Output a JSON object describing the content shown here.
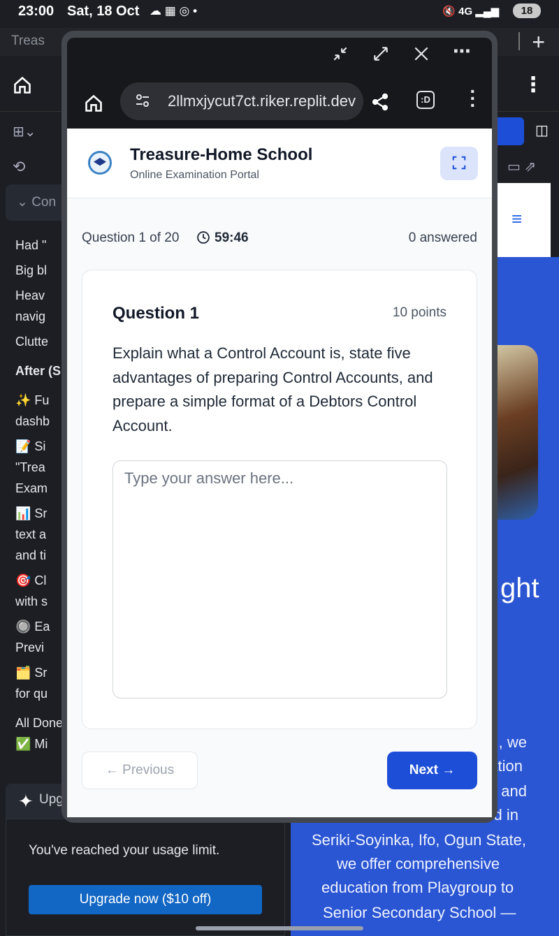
{
  "status_bar": {
    "time": "23:00",
    "date": "Sat, 18 Oct",
    "battery": "18"
  },
  "background": {
    "tab_title": "Treas",
    "conversation_label": "Con",
    "left_lines": [
      "Had \"",
      "Big bl",
      "Heav",
      "navig",
      "Clutte",
      "After (S",
      "✨ Fu",
      "dashb",
      "📝 Si",
      "\"Trea",
      "Exam",
      "📊 Sr",
      "text a",
      "and ti",
      "🎯 Cl",
      "with s",
      "🔘 Ea",
      "Previ",
      "🗂️ Sr",
      "for qu",
      "All Done",
      "✅ Mi"
    ],
    "upgrade_head": "Upg",
    "usage_limit": "You've reached your usage limit.",
    "upgrade_button": "Upgrade now ($10 off)",
    "right_heading_fragment": "ght",
    "bottom_text": [
      ", we",
      "ation",
      "and",
      "d in",
      "Seriki-Soyinka, Ifo, Ogun State,",
      "we offer comprehensive",
      "education from Playgroup to",
      "Senior Secondary School —"
    ]
  },
  "popup": {
    "url": "2llmxjycut7ct.riker.replit.dev",
    "dbadge": ":D"
  },
  "header": {
    "school_name": "Treasure-Home School",
    "subtitle": "Online Examination Portal"
  },
  "exam": {
    "question_count": "Question 1 of 20",
    "timer": "59:46",
    "answered": "0 answered",
    "question_title": "Question 1",
    "points": "10 points",
    "question_text": "Explain what a Control Account is, state five advantages of preparing Control Accounts, and prepare a simple format of a Debtors Control Account.",
    "answer_placeholder": "Type your answer here...",
    "answer_value": "",
    "prev_label": "← Previous",
    "next_label": "Next →"
  }
}
